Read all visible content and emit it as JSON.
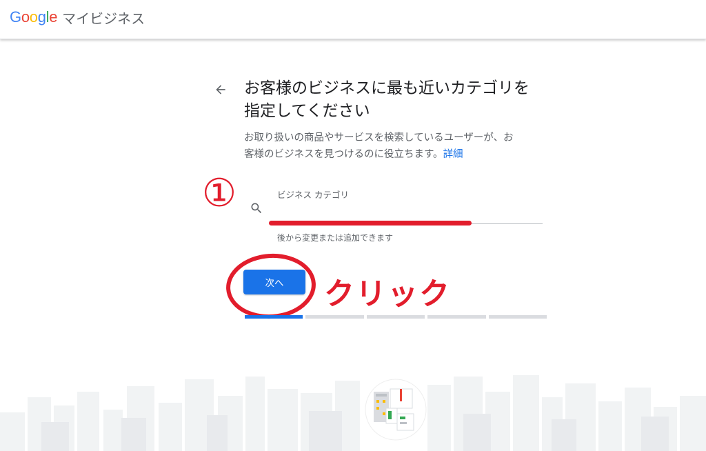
{
  "header": {
    "logo": {
      "letters": [
        {
          "ch": "G",
          "color": "#4285F4"
        },
        {
          "ch": "o",
          "color": "#EA4335"
        },
        {
          "ch": "o",
          "color": "#FBBC05"
        },
        {
          "ch": "g",
          "color": "#4285F4"
        },
        {
          "ch": "l",
          "color": "#34A853"
        },
        {
          "ch": "e",
          "color": "#EA4335"
        }
      ],
      "product": "マイビジネス"
    }
  },
  "main": {
    "back_icon": "arrow-back-icon",
    "title_line1": "お客様のビジネスに最も近いカテゴリを",
    "title_line2": "指定してください",
    "description_line1": "お取り扱いの商品やサービスを検索しているユーザーが、お",
    "description_line2": "客様のビジネスを見つけるのに役立ちます。",
    "details_link": "詳細",
    "category_field": {
      "label": "ビジネス カテゴリ",
      "value": "",
      "helper": "後から変更または追加できます",
      "icon": "search-icon"
    },
    "next_button": "次へ",
    "progress": {
      "total_steps": 5,
      "current_step": 1
    }
  },
  "annotations": {
    "step_number": "①",
    "click_label": "クリック",
    "color": "#e21d2c"
  },
  "colors": {
    "accent": "#1a73e8",
    "text_primary": "#202124",
    "text_secondary": "#5f6368",
    "track": "#dadce0"
  }
}
